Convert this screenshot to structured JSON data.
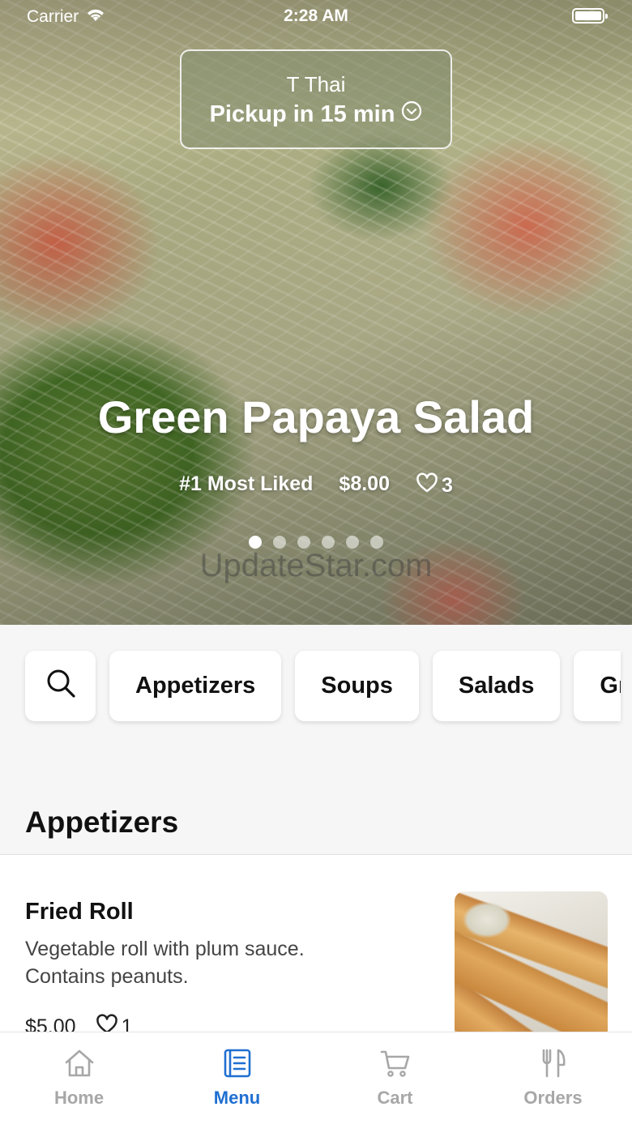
{
  "status_bar": {
    "carrier": "Carrier",
    "time": "2:28 AM"
  },
  "pickup": {
    "store": "T Thai",
    "eta": "Pickup in 15 min"
  },
  "hero": {
    "title": "Green Papaya Salad",
    "badge": "#1 Most Liked",
    "price": "$8.00",
    "likes": "3",
    "slide_count": 6,
    "active_slide": 1,
    "watermark": "UpdateStar.com"
  },
  "categories": [
    "Appetizers",
    "Soups",
    "Salads",
    "Gr"
  ],
  "section": {
    "title": "Appetizers"
  },
  "items": [
    {
      "name": "Fried Roll",
      "description": "Vegetable roll with plum sauce. Contains peanuts.",
      "price": "$5.00",
      "likes": "1"
    }
  ],
  "tabs": [
    {
      "label": "Home",
      "icon": "home-icon",
      "active": false
    },
    {
      "label": "Menu",
      "icon": "menu-icon",
      "active": true
    },
    {
      "label": "Cart",
      "icon": "cart-icon",
      "active": false
    },
    {
      "label": "Orders",
      "icon": "orders-icon",
      "active": false
    }
  ],
  "colors": {
    "accent": "#1f6fd1",
    "inactive_tab": "#a7a7a7"
  }
}
